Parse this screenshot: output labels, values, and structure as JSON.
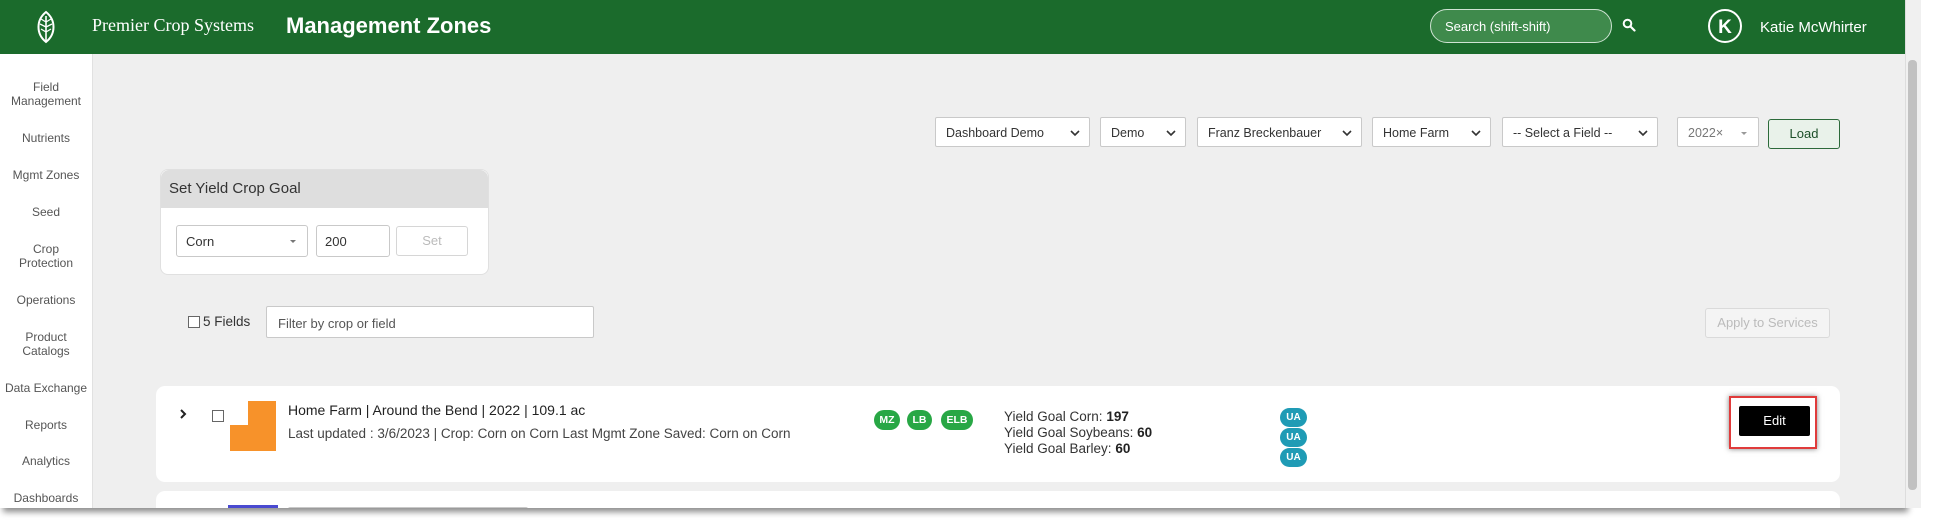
{
  "header": {
    "brand": "Premier Crop Systems",
    "page_title": "Management Zones",
    "search_placeholder": "Search (shift-shift)",
    "user_initial": "K",
    "user_name": "Katie McWhirter",
    "bg_color": "#1b6b2c"
  },
  "sidebar": {
    "items": [
      {
        "line1": "Field",
        "line2": "Management"
      },
      {
        "line1": "Nutrients",
        "line2": ""
      },
      {
        "line1": "Mgmt Zones",
        "line2": ""
      },
      {
        "line1": "Seed",
        "line2": ""
      },
      {
        "line1": "Crop",
        "line2": "Protection"
      },
      {
        "line1": "Operations",
        "line2": ""
      },
      {
        "line1": "Product",
        "line2": "Catalogs"
      },
      {
        "line1": "Data Exchange",
        "line2": ""
      },
      {
        "line1": "Reports",
        "line2": ""
      },
      {
        "line1": "Analytics",
        "line2": ""
      },
      {
        "line1": "Dashboards",
        "line2": ""
      }
    ]
  },
  "filters": {
    "dashboard": "Dashboard Demo",
    "group": "Demo",
    "grower": "Franz Breckenbauer",
    "farm": "Home Farm",
    "field": "-- Select a Field --",
    "year": "2022",
    "year_clear": "×",
    "load_label": "Load"
  },
  "yield_goal": {
    "title": "Set Yield Crop Goal",
    "crop": "Corn",
    "value": "200",
    "set_label": "Set"
  },
  "list": {
    "fields_count": "5 Fields",
    "filter_placeholder": "Filter by crop or field",
    "apply_label": "Apply to Services"
  },
  "rows": [
    {
      "title": "Home Farm | Around the Bend | 2022 | 109.1 ac",
      "meta": "Last updated : 3/6/2023 | Crop: Corn on Corn   Last Mgmt Zone Saved: Corn on Corn",
      "badges": [
        "MZ",
        "LB",
        "ELB"
      ],
      "yield_goals": [
        {
          "label": "Yield Goal Corn:",
          "value": "197"
        },
        {
          "label": "Yield Goal Soybeans:",
          "value": "60"
        },
        {
          "label": "Yield Goal Barley:",
          "value": "60"
        }
      ],
      "ua_tags": [
        "UA",
        "UA",
        "UA"
      ],
      "edit_label": "Edit",
      "thumb_color": "#f7922a"
    }
  ],
  "colors": {
    "accent_green": "#1b6b2c",
    "badge_green": "#28a745",
    "ua_teal": "#1f9bb5",
    "highlight_red": "#e03b3b"
  }
}
